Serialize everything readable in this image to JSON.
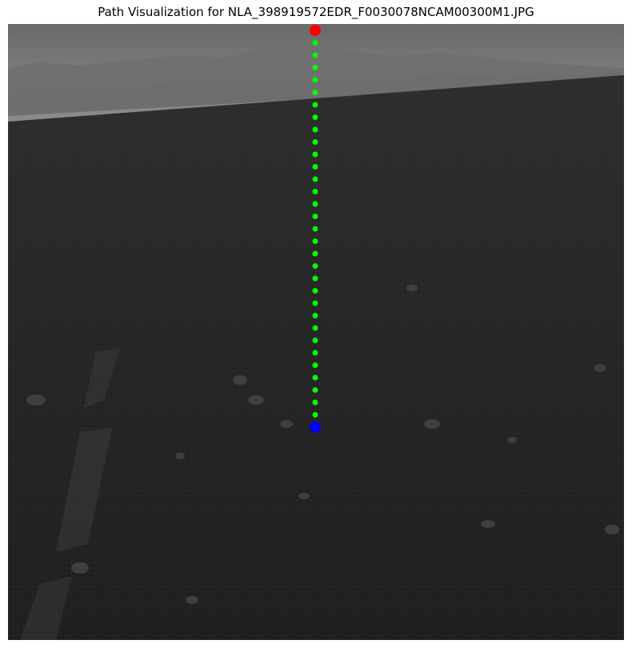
{
  "figure": {
    "title": "Path Visualization for NLA_398919572EDR_F0030078NCAM00300M1.JPG"
  },
  "path": {
    "start_color": "#0000ff",
    "end_color": "#ff0000",
    "waypoint_color": "#00ff00",
    "waypoint_count": 31
  },
  "colors": {
    "sky": "#8a8a8a",
    "terrain": "#262626"
  }
}
